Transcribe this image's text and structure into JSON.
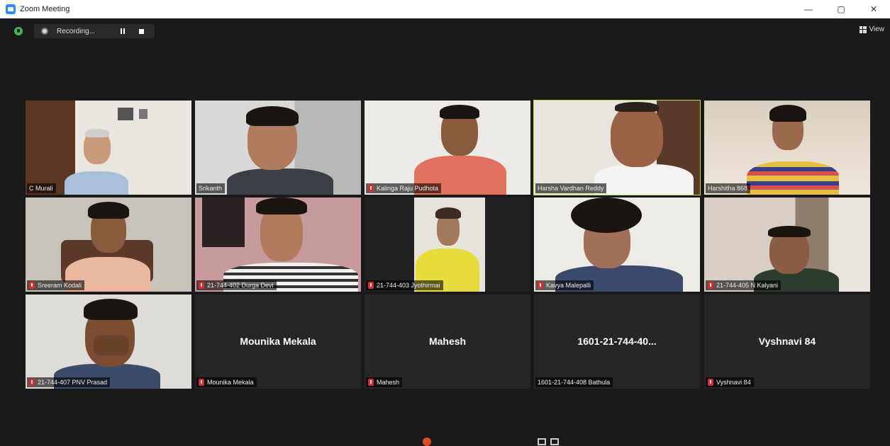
{
  "window": {
    "title": "Zoom Meeting",
    "minimize": "—",
    "maximize": "▢",
    "close": "✕"
  },
  "topbar": {
    "recording_label": "Recording...",
    "view_label": "View"
  },
  "tiles": [
    {
      "name": "C Murali",
      "muted": false,
      "video": true
    },
    {
      "name": "Srikanth",
      "muted": false,
      "video": true
    },
    {
      "name": "Kalinga Raju Pudhota",
      "muted": true,
      "video": true
    },
    {
      "name": "Harsha Vardhan Reddy",
      "muted": false,
      "video": true,
      "active": true
    },
    {
      "name": "Harshitha 868",
      "muted": false,
      "video": true
    },
    {
      "name": "Sreeram Kodali",
      "muted": true,
      "video": true
    },
    {
      "name": "21-744-402 Durga Devi",
      "muted": true,
      "video": true
    },
    {
      "name": "21-744-403 Jyothirmai",
      "muted": true,
      "video": true
    },
    {
      "name": "Kavya Malepalli",
      "muted": true,
      "video": true
    },
    {
      "name": "21-744-405 N Kalyani",
      "muted": true,
      "video": true
    },
    {
      "name": "21-744-407 PNV Prasad",
      "muted": true,
      "video": true
    },
    {
      "name": "Mounika Mekala",
      "muted": true,
      "video": false,
      "display": "Mounika Mekala"
    },
    {
      "name": "Mahesh",
      "muted": true,
      "video": false,
      "display": "Mahesh"
    },
    {
      "name": "1601-21-744-408 Bathula",
      "muted": false,
      "video": false,
      "display": "1601-21-744-40..."
    },
    {
      "name": "Vyshnavi 84",
      "muted": true,
      "video": false,
      "display": "Vyshnavi 84"
    }
  ]
}
